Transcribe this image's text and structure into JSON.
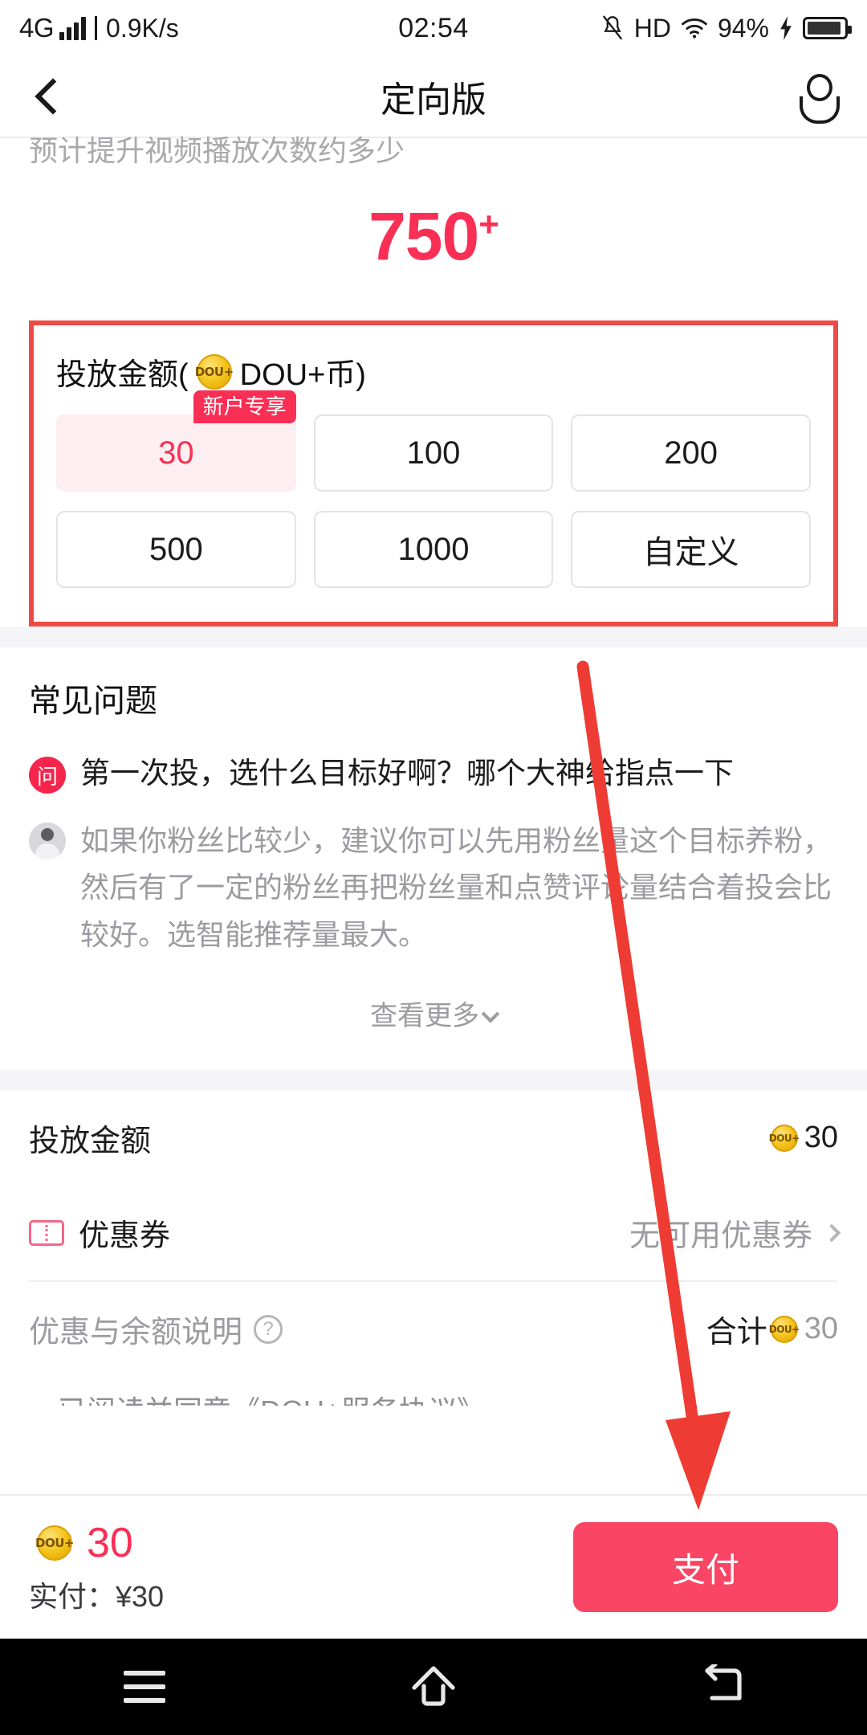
{
  "statusbar": {
    "network": "4G",
    "speed": "0.9K/s",
    "time": "02:54",
    "hd": "HD",
    "battery_percent": "94%",
    "signal_icon": "signal-bars-icon",
    "mute_icon": "bell-muted-icon",
    "wifi_icon": "wifi-icon",
    "charging_icon": "charging-bolt-icon",
    "battery_icon": "battery-icon"
  },
  "header": {
    "back_icon": "back-chevron-icon",
    "title": "定向版",
    "profile_icon": "person-icon"
  },
  "hero": {
    "clipped_caption": "预计提升视频播放次数约多少",
    "big_number": "750",
    "big_number_suffix": "+"
  },
  "amount_card": {
    "label_prefix": "投放金额(",
    "coin_icon": "dou-plus-coin-icon",
    "coin_text": "DOU+",
    "label_suffix": "DOU+币)",
    "options": [
      {
        "value": "30",
        "selected": true,
        "badge": "新户专享"
      },
      {
        "value": "100",
        "selected": false,
        "badge": ""
      },
      {
        "value": "200",
        "selected": false,
        "badge": ""
      },
      {
        "value": "500",
        "selected": false,
        "badge": ""
      },
      {
        "value": "1000",
        "selected": false,
        "badge": ""
      },
      {
        "value": "自定义",
        "selected": false,
        "badge": ""
      }
    ]
  },
  "faq": {
    "title": "常见问题",
    "question_badge": "问",
    "question": "第一次投，选什么目标好啊？哪个大神给指点一下",
    "avatar_icon": "user-avatar-icon",
    "answer": "如果你粉丝比较少，建议你可以先用粉丝量这个目标养粉，然后有了一定的粉丝再把粉丝量和点赞评论量结合着投会比较好。选智能推荐量最大。",
    "more_label": "查看更多",
    "more_icon": "chevron-down-icon"
  },
  "summary": {
    "rows": [
      {
        "label": "投放金额",
        "value": "30",
        "coin": true,
        "icon": "",
        "chevron": false,
        "muted": false
      },
      {
        "label": "优惠券",
        "value": "无可用优惠券",
        "coin": false,
        "icon": "coupon-icon",
        "chevron": true,
        "muted": true
      }
    ],
    "explain_label": "优惠与余额说明",
    "explain_icon": "question-mark-icon",
    "total_label": "合计",
    "total_value": "30",
    "agreement_clipped": "已阅读并同意《DOU+服务协议》"
  },
  "paybar": {
    "coin_icon": "dou-plus-coin-icon",
    "amount": "30",
    "actual_label": "实付：¥30",
    "pay_button": "支付"
  },
  "androidnav": {
    "menu_icon": "menu-icon",
    "home_icon": "home-icon",
    "back_icon": "back-arrow-icon"
  },
  "annotation": {
    "highlight_color": "#ef4a45",
    "arrow_color": "#ee3b33",
    "accent_color": "#fa2f55"
  }
}
